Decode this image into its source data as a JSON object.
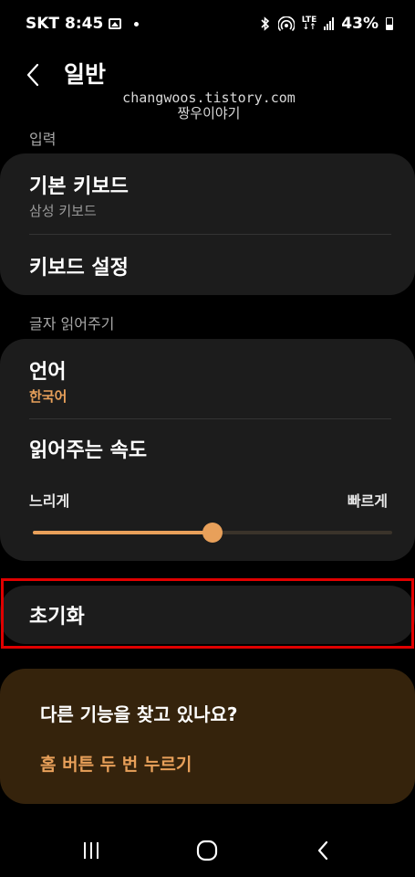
{
  "status_bar": {
    "carrier": "SKT",
    "time": "8:45",
    "network": "LTE",
    "battery": "43%",
    "icons": [
      "image-icon",
      "dot-icon",
      "bluetooth-icon",
      "hotspot-icon",
      "lte-icon",
      "signal-icon",
      "battery-icon"
    ]
  },
  "header": {
    "title": "일반"
  },
  "watermark": {
    "line1": "changwoos.tistory.com",
    "line2": "짱우이야기"
  },
  "sections": {
    "input_label": "입력",
    "tts_label": "글자 읽어주기"
  },
  "input_card": {
    "default_keyboard_title": "기본 키보드",
    "default_keyboard_value": "삼성 키보드",
    "keyboard_settings_title": "키보드 설정"
  },
  "tts_card": {
    "language_title": "언어",
    "language_value": "한국어",
    "speech_rate_title": "읽어주는 속도",
    "slow_label": "느리게",
    "fast_label": "빠르게",
    "speech_rate_value": 0.5
  },
  "reset_card": {
    "title": "초기화"
  },
  "promo": {
    "title": "다른 기능을 찾고 있나요?",
    "link": "홈 버튼 두 번 누르기"
  },
  "colors": {
    "accent": "#e8a05a",
    "highlight": "#e00000",
    "card": "#1c1c1c",
    "promo_bg": "#35230c"
  }
}
